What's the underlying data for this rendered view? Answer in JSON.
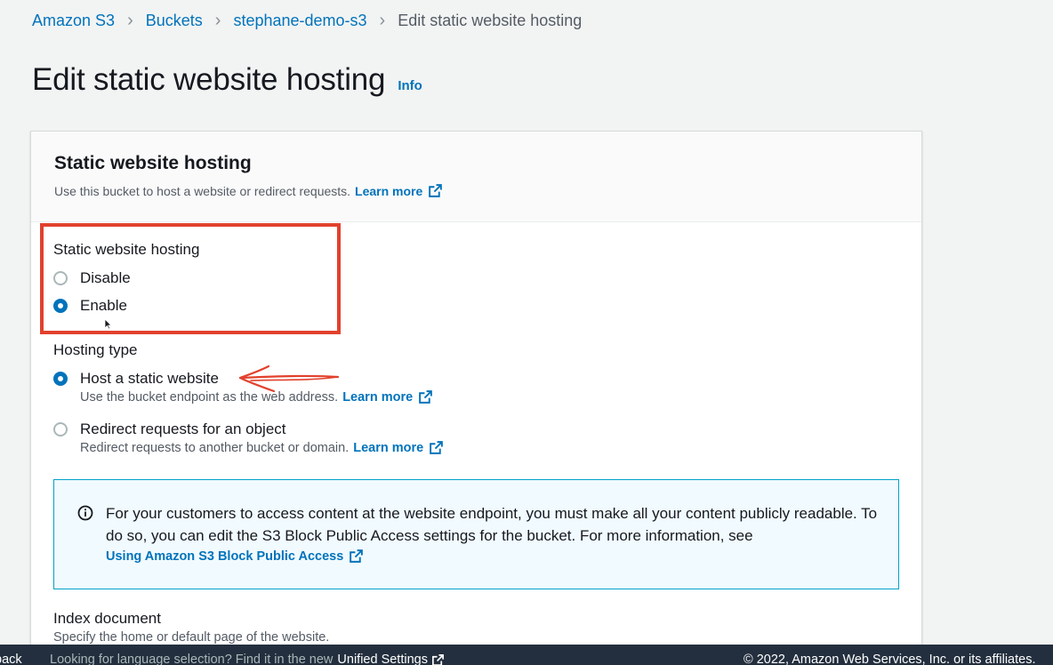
{
  "breadcrumb": {
    "items": [
      "Amazon S3",
      "Buckets",
      "stephane-demo-s3"
    ],
    "current": "Edit static website hosting"
  },
  "page": {
    "title": "Edit static website hosting",
    "info_link": "Info"
  },
  "panel": {
    "title": "Static website hosting",
    "description": "Use this bucket to host a website or redirect requests.",
    "learn_more": "Learn more"
  },
  "hosting_toggle": {
    "label": "Static website hosting",
    "options": [
      {
        "label": "Disable",
        "checked": false
      },
      {
        "label": "Enable",
        "checked": true
      }
    ]
  },
  "hosting_type": {
    "label": "Hosting type",
    "options": [
      {
        "label": "Host a static website",
        "description": "Use the bucket endpoint as the web address.",
        "learn_more": "Learn more",
        "checked": true
      },
      {
        "label": "Redirect requests for an object",
        "description": "Redirect requests to another bucket or domain.",
        "learn_more": "Learn more",
        "checked": false
      }
    ]
  },
  "alert": {
    "text": "For your customers to access content at the website endpoint, you must make all your content publicly readable. To do so, you can edit the S3 Block Public Access settings for the bucket. For more information, see",
    "link": "Using Amazon S3 Block Public Access"
  },
  "index_document": {
    "label": "Index document",
    "description": "Specify the home or default page of the website."
  },
  "footer": {
    "feedback": "back",
    "language_prompt": "Looking for language selection? Find it in the new",
    "unified_settings": "Unified Settings",
    "copyright": "© 2022, Amazon Web Services, Inc. or its affiliates."
  },
  "colors": {
    "link": "#0073bb",
    "annotation_red": "#e2412d",
    "footer_bg": "#232f3e",
    "alert_bg": "#f1faff",
    "alert_border": "#00a1c9"
  }
}
